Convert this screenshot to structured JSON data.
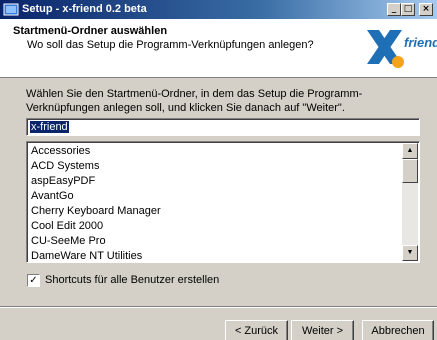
{
  "window": {
    "title": "Setup - x-friend 0.2 beta",
    "controls": {
      "minimize": "_",
      "maximize": "□",
      "close": "×"
    }
  },
  "header": {
    "title": "Startmenü-Ordner auswählen",
    "subtitle": "Wo soll das Setup die Programm-Verknüpfungen anlegen?",
    "logo_text": "friend",
    "logo_colors": {
      "x": "#1f6fb6",
      "dot": "#f5a31a",
      "text": "#1f6fb6"
    }
  },
  "main": {
    "intro_text": "Wählen Sie den Startmenü-Ordner, in dem das Setup die Programm-Verknüpfungen anlegen soll, und klicken Sie danach auf \"Weiter\".",
    "folder_value": "x-friend",
    "folder_list": [
      "Accessories",
      "ACD Systems",
      "aspEasyPDF",
      "AvantGo",
      "Cherry Keyboard Manager",
      "Cool Edit 2000",
      "CU-SeeMe Pro",
      "DameWare NT Utilities"
    ],
    "checkbox": {
      "label": "Shortcuts für alle Benutzer erstellen",
      "checked": true,
      "mark": "✓"
    }
  },
  "buttons": {
    "back": "< Zurück",
    "next": "Weiter >",
    "cancel": "Abbrechen"
  }
}
